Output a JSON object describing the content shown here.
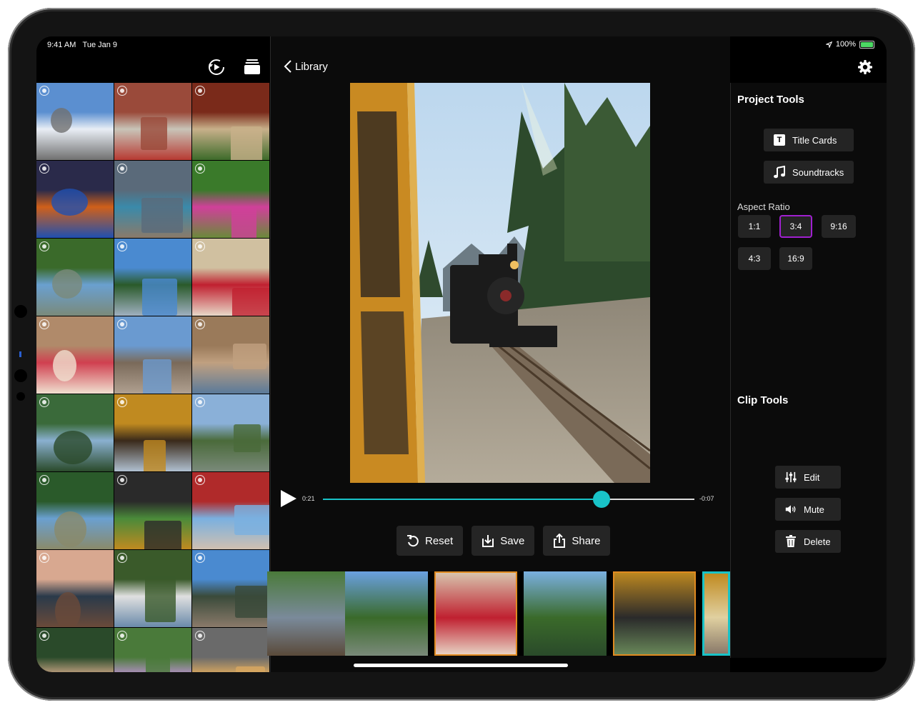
{
  "status_bar": {
    "time": "9:41 AM",
    "date": "Tue Jan 9",
    "battery": "100%"
  },
  "library": {
    "toolbar_icons": [
      "replay-icon",
      "stack-icon"
    ],
    "photos": [
      {
        "label": "road under clouds"
      },
      {
        "label": "storefront"
      },
      {
        "label": "balcony child"
      },
      {
        "label": "arcade cabinet"
      },
      {
        "label": "bridge walkway"
      },
      {
        "label": "pink flowers"
      },
      {
        "label": "creek in forest"
      },
      {
        "label": "mountain peak"
      },
      {
        "label": "mom and child"
      },
      {
        "label": "child eating"
      },
      {
        "label": "town street"
      },
      {
        "label": "playground"
      },
      {
        "label": "pine hillside"
      },
      {
        "label": "child on train"
      },
      {
        "label": "valley view"
      },
      {
        "label": "forest creek"
      },
      {
        "label": "steam train"
      },
      {
        "label": "red building"
      },
      {
        "label": "dusk mountains"
      },
      {
        "label": "railroad crossing"
      },
      {
        "label": "mountain town"
      },
      {
        "label": "child in doorway"
      },
      {
        "label": "garden flowers"
      },
      {
        "label": "cloudy sky"
      }
    ]
  },
  "editor": {
    "back_label": "Library",
    "time_elapsed": "0:21",
    "time_remaining": "-0:07",
    "progress": 0.75,
    "actions": {
      "reset": "Reset",
      "save": "Save",
      "share": "Share"
    },
    "timeline_clips": [
      "creek",
      "mountain",
      "mom and child",
      "pine hillside",
      "child on train",
      "train window"
    ]
  },
  "tools": {
    "project_title": "Project Tools",
    "title_cards": "Title Cards",
    "soundtracks": "Soundtracks",
    "aspect_title": "Aspect Ratio",
    "ratios": [
      "1:1",
      "3:4",
      "9:16",
      "4:3",
      "16:9"
    ],
    "selected_ratio": "3:4",
    "clip_title": "Clip Tools",
    "edit": "Edit",
    "mute": "Mute",
    "delete": "Delete"
  },
  "colors": {
    "accent": "#19c3c8",
    "selection": "#a020d0"
  }
}
